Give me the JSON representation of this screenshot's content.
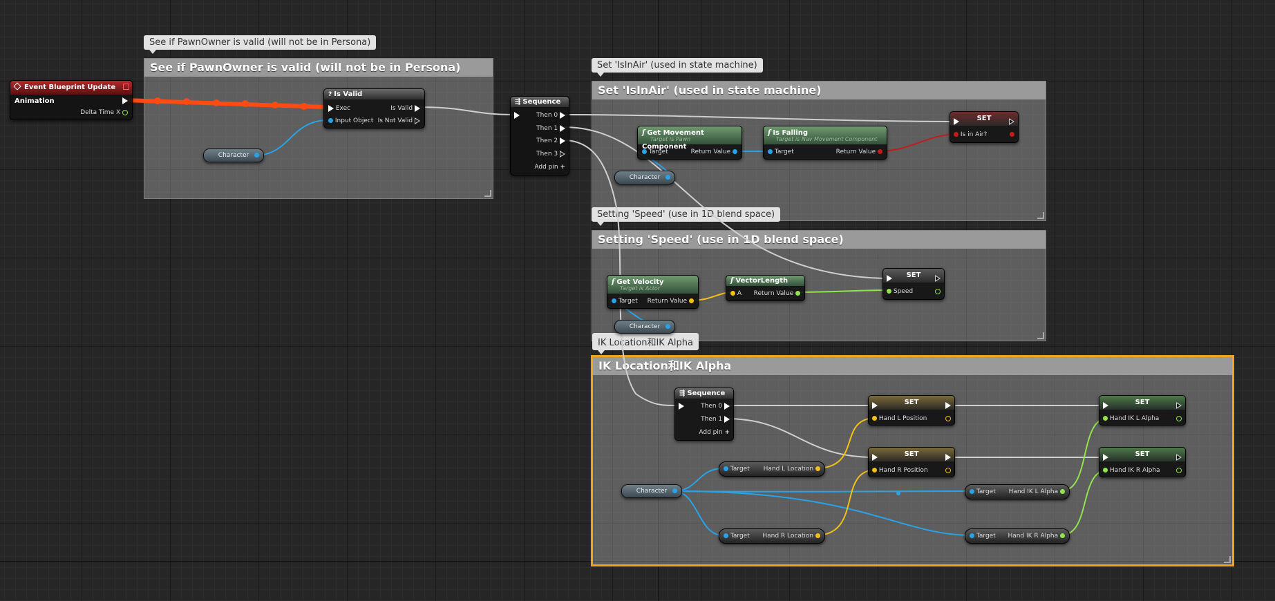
{
  "comments": {
    "pawn_valid": "See if PawnOwner is valid (will not be in Persona)",
    "is_in_air": "Set 'IsInAir' (used in state machine)",
    "speed": "Setting 'Speed' (use in 1D blend space)",
    "ik": "IK Location和IK Alpha"
  },
  "event_node": {
    "title": "Event Blueprint Update Animation",
    "delta": "Delta Time X"
  },
  "is_valid_node": {
    "title": "Is Valid",
    "exec": "Exec",
    "input": "Input Object",
    "out_valid": "Is Valid",
    "out_not_valid": "Is Not Valid"
  },
  "character_label": "Character",
  "sequence1": {
    "title": "Sequence",
    "then0": "Then 0",
    "then1": "Then 1",
    "then2": "Then 2",
    "then3": "Then 3",
    "add_pin": "Add pin"
  },
  "get_movement": {
    "title": "Get Movement Component",
    "sub": "Target is Pawn",
    "target": "Target",
    "ret": "Return Value"
  },
  "is_falling": {
    "title": "Is Falling",
    "sub": "Target is Nav Movement Component",
    "target": "Target",
    "ret": "Return Value"
  },
  "set_in_air": {
    "title": "SET",
    "pin": "Is in Air?"
  },
  "get_velocity": {
    "title": "Get Velocity",
    "sub": "Target is Actor",
    "target": "Target",
    "ret": "Return Value"
  },
  "vector_length": {
    "title": "VectorLength",
    "a": "A",
    "ret": "Return Value"
  },
  "set_speed": {
    "title": "SET",
    "pin": "Speed"
  },
  "sequence2": {
    "title": "Sequence",
    "then0": "Then 0",
    "then1": "Then 1",
    "add_pin": "Add pin"
  },
  "hand_l_location": {
    "target": "Target",
    "value": "Hand L Location"
  },
  "hand_r_location": {
    "target": "Target",
    "value": "Hand R Location"
  },
  "set_l_position": {
    "title": "SET",
    "pin": "Hand L Position"
  },
  "set_r_position": {
    "title": "SET",
    "pin": "Hand R Position"
  },
  "hand_ik_l_alpha": {
    "target": "Target",
    "value": "Hand IK L Alpha"
  },
  "hand_ik_r_alpha": {
    "target": "Target",
    "value": "Hand IK R Alpha"
  },
  "set_ik_l_alpha": {
    "title": "SET",
    "pin": "Hand IK L Alpha"
  },
  "set_ik_r_alpha": {
    "title": "SET",
    "pin": "Hand IK R Alpha"
  },
  "colors": {
    "exec_active": "#ff4a12",
    "object_pin": "#29a3e8",
    "vector_pin": "#f3c018",
    "float_pin": "#92e34c",
    "bool_pin": "#c11d1d",
    "selection": "#f4a21c"
  }
}
